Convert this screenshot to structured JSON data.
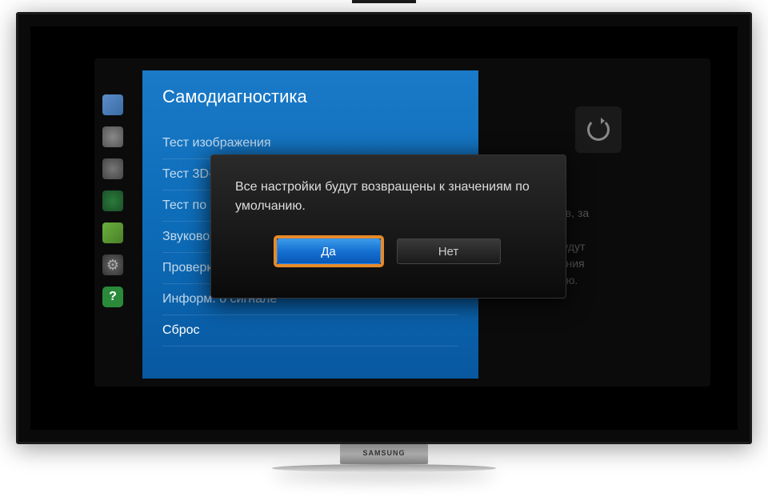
{
  "tv": {
    "brand": "SAMSUNG"
  },
  "panel": {
    "title": "Самодиагностика",
    "items": [
      "Тест изображения",
      "Тест 3D-",
      "Тест по",
      "Звуковой",
      "Проверка",
      "Информ. о сигнале",
      "Сброс"
    ]
  },
  "rightPanel": {
    "description": "х параметров, за\nением\nтров сети, будут\nвлены значения\nпо умолчанию."
  },
  "dialog": {
    "message": "Все настройки будут возвращены к значениям по умолчанию.",
    "yes": "Да",
    "no": "Нет"
  }
}
